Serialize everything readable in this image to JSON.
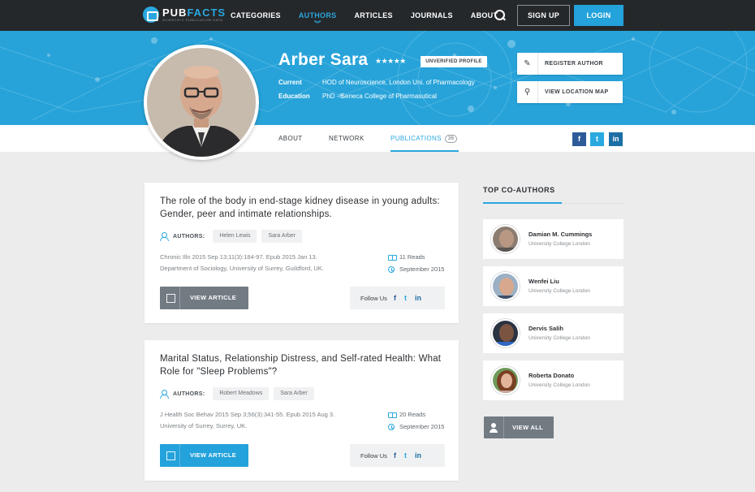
{
  "brand": {
    "name_a": "PUB",
    "name_b": "FACTS",
    "tagline": "SCIENTIFIC PUBLICATION DATA"
  },
  "nav": {
    "items": [
      {
        "label": "CATEGORIES"
      },
      {
        "label": "AUTHORS",
        "active": true
      },
      {
        "label": "ARTICLES"
      },
      {
        "label": "JOURNALS"
      },
      {
        "label": "ABOUT"
      }
    ],
    "signup": "SIGN UP",
    "login": "LOGIN"
  },
  "profile": {
    "name": "Arber Sara",
    "rating": 5,
    "stars": "★★★★★",
    "badge": "UNVERIFIED PROFILE",
    "current_label": "Current",
    "current_value": "HOD of Neuroscience, London Uni. of Pharmacology",
    "education_label": "Education",
    "education_value": "PhD - Seneca College of Pharmasutical",
    "register_btn": "REGISTER AUTHOR",
    "location_btn": "VIEW LOCATION MAP"
  },
  "tabs": [
    {
      "label": "ABOUT"
    },
    {
      "label": "NETWORK"
    },
    {
      "label": "PUBLICATIONS",
      "count": "36",
      "active": true
    }
  ],
  "social": {
    "fb": "f",
    "tw": "t",
    "li": "in"
  },
  "publications": [
    {
      "title": "The role of the body in end-stage kidney disease in young adults: Gender, peer and intimate relationships.",
      "authors_label": "AUTHORS:",
      "authors": [
        "Helen Lewis",
        "Sara Arber"
      ],
      "citation": "Chronic Illn 2015 Sep 13;11(3):184-97. Epub 2015 Jan 13.",
      "affiliation": "Department of Sociology, University of Surrey, Guildford, UK.",
      "reads": "11 Reads",
      "date": "September 2015",
      "button": "VIEW ARTICLE",
      "button_style": "gray",
      "follow": "Follow Us"
    },
    {
      "title": "Marital Status, Relationship Distress, and Self-rated Health: What Role for \"Sleep Problems\"?",
      "authors_label": "AUTHORS:",
      "authors": [
        "Robert Meadows",
        "Sara Arber"
      ],
      "citation": "J Health Soc Behav 2015 Sep 3;56(3):341-55. Epub 2015 Aug 3.",
      "affiliation": "University of Surrey, Surrey, UK.",
      "reads": "20 Reads",
      "date": "September 2015",
      "button": "VIEW ARTICLE",
      "button_style": "blue",
      "follow": "Follow Us"
    }
  ],
  "coauthors": {
    "title": "TOP CO-AUTHORS",
    "items": [
      {
        "name": "Damian M. Cummings",
        "affiliation": "University College London"
      },
      {
        "name": "Wenfei Liu",
        "affiliation": "University College London"
      },
      {
        "name": "Dervis Salih",
        "affiliation": "University College London"
      },
      {
        "name": "Roberta Donato",
        "affiliation": "University College London"
      }
    ],
    "view_all": "VIEW ALL"
  },
  "colors": {
    "accent": "#2aa7df",
    "nav_bg": "#25282b",
    "hero_bg": "#27a3d9"
  }
}
